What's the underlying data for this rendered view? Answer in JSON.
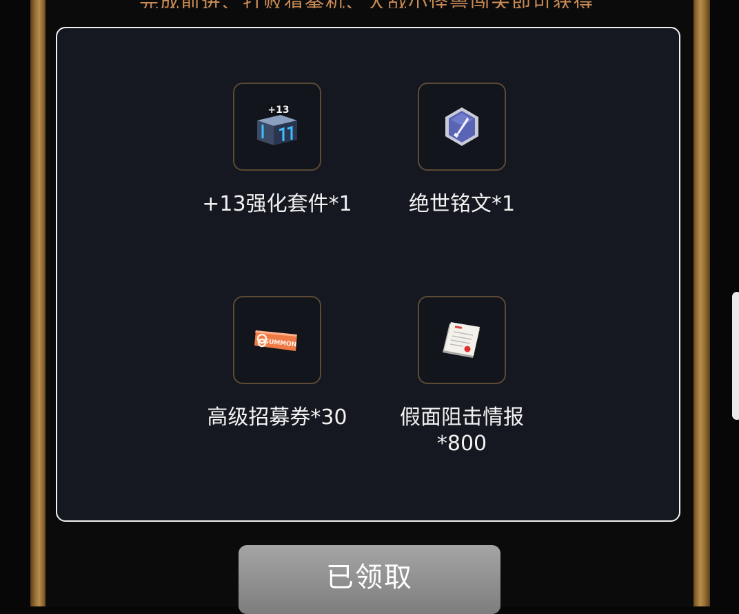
{
  "header": {
    "partial_text": "完成前进、打败猜拳机、大战小怪兽闯关即可获得"
  },
  "rewards": [
    {
      "label": "+13强化套件*1",
      "icon": "enhancement-kit-icon",
      "badge": "+13"
    },
    {
      "label": "绝世铭文*1",
      "icon": "inscription-gem-icon"
    },
    {
      "label": "高级招募券*30",
      "icon": "summon-ticket-icon",
      "ticket_text": "SUMMON"
    },
    {
      "label": "假面阻击情报*800",
      "icon": "intel-document-icon"
    }
  ],
  "claim_button": {
    "label": "已领取",
    "state": "claimed"
  },
  "colors": {
    "frame_gold": "#b98e4c",
    "panel_border": "#f2f2f2",
    "slot_border": "#5c4a34",
    "button_gray": "#8f8f8f"
  }
}
